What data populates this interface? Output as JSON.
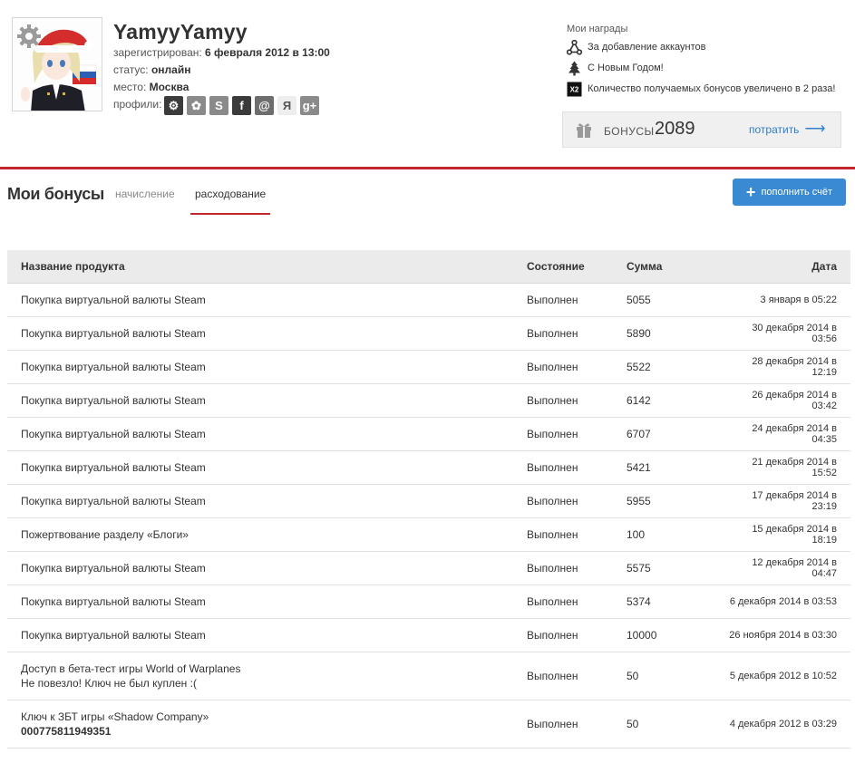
{
  "profile": {
    "username": "YamyyYamyy",
    "registered_label": "зарегистрирован:",
    "registered_value": "6 февраля 2012 в 13:00",
    "status_label": "статус:",
    "status_value": "онлайн",
    "place_label": "место:",
    "place_value": "Москва",
    "profiles_label": "профили:",
    "profile_icons": [
      {
        "name": "steam-icon",
        "glyph": "⚙",
        "color": "#3b3b3b"
      },
      {
        "name": "flower-icon",
        "glyph": "✿",
        "color": "#8a8a8a"
      },
      {
        "name": "skype-icon",
        "glyph": "S",
        "color": "#8a8a8a"
      },
      {
        "name": "facebook-icon",
        "glyph": "f",
        "color": "#3b3b3b"
      },
      {
        "name": "email-icon",
        "glyph": "@",
        "color": "#6d6d6d"
      },
      {
        "name": "yandex-icon",
        "glyph": "Я",
        "color": "#eeeeee"
      },
      {
        "name": "google-plus-icon",
        "glyph": "g+",
        "color": "#8a8a8a"
      }
    ]
  },
  "awards": {
    "title": "Мои награды",
    "items": [
      {
        "label": "За добавление аккаунтов",
        "icon": "network-icon"
      },
      {
        "label": "С Новым Годом!",
        "icon": "tree-icon"
      },
      {
        "label": "Количество получаемых бонусов увеличено в 2 раза!",
        "icon": "x2-icon"
      }
    ]
  },
  "bonus": {
    "label": "БОНУСЫ",
    "value": "2089",
    "spend_label": "потратить",
    "spend_arrow": "⟶"
  },
  "section": {
    "title": "Мои бонусы",
    "tabs": [
      {
        "label": "начисление",
        "active": false
      },
      {
        "label": "расходование",
        "active": true
      }
    ],
    "topup_label": "пополнить счёт",
    "topup_plus": "+"
  },
  "table": {
    "headers": {
      "name": "Название продукта",
      "state": "Состояние",
      "sum": "Сумма",
      "date": "Дата"
    },
    "rows": [
      {
        "name": "Покупка виртуальной валюты Steam",
        "state": "Выполнен",
        "sum": "5055",
        "date": "3 января в 05:22"
      },
      {
        "name": "Покупка виртуальной валюты Steam",
        "state": "Выполнен",
        "sum": "5890",
        "date": "30 декабря 2014 в 03:56"
      },
      {
        "name": "Покупка виртуальной валюты Steam",
        "state": "Выполнен",
        "sum": "5522",
        "date": "28 декабря 2014 в 12:19"
      },
      {
        "name": "Покупка виртуальной валюты Steam",
        "state": "Выполнен",
        "sum": "6142",
        "date": "26 декабря 2014 в 03:42"
      },
      {
        "name": "Покупка виртуальной валюты Steam",
        "state": "Выполнен",
        "sum": "6707",
        "date": "24 декабря 2014 в 04:35"
      },
      {
        "name": "Покупка виртуальной валюты Steam",
        "state": "Выполнен",
        "sum": "5421",
        "date": "21 декабря 2014 в 15:52"
      },
      {
        "name": "Покупка виртуальной валюты Steam",
        "state": "Выполнен",
        "sum": "5955",
        "date": "17 декабря 2014 в 23:19"
      },
      {
        "name": "Пожертвование разделу «Блоги»",
        "state": "Выполнен",
        "sum": "100",
        "date": "15 декабря 2014 в 18:19"
      },
      {
        "name": "Покупка виртуальной валюты Steam",
        "state": "Выполнен",
        "sum": "5575",
        "date": "12 декабря 2014 в 04:47"
      },
      {
        "name": "Покупка виртуальной валюты Steam",
        "state": "Выполнен",
        "sum": "5374",
        "date": "6 декабря 2014 в 03:53"
      },
      {
        "name": "Покупка виртуальной валюты Steam",
        "state": "Выполнен",
        "sum": "10000",
        "date": "26 ноября 2014 в 03:30"
      },
      {
        "name": "Доступ в бета-тест игры World of Warplanes",
        "note": "Не повезло! Ключ не был куплен :(",
        "note_bold": false,
        "state": "Выполнен",
        "sum": "50",
        "date": "5 декабря 2012 в 10:52"
      },
      {
        "name": "Ключ к ЗБТ игры «Shadow Company»",
        "note": "000775811949351",
        "note_bold": true,
        "state": "Выполнен",
        "sum": "50",
        "date": "4 декабря 2012 в 03:29"
      }
    ]
  },
  "colors": {
    "accent_red": "#c0282d",
    "button_blue": "#3a8ad3",
    "link_blue": "#2f7fc9"
  }
}
